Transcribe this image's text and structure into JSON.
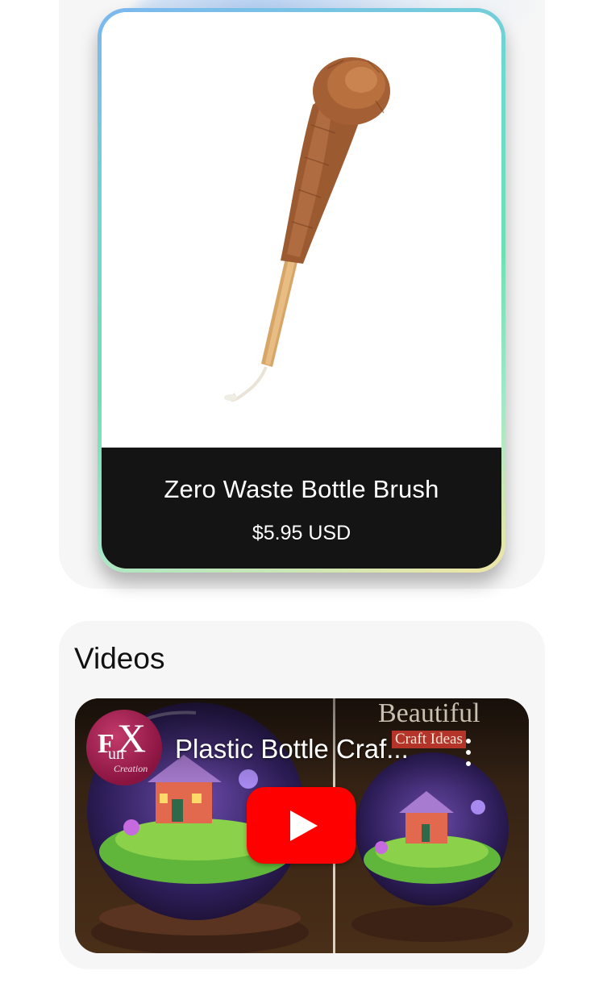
{
  "product": {
    "title": "Zero Waste Bottle Brush",
    "price": "$5.95 USD",
    "image": "bottle-brush-photo"
  },
  "videos": {
    "heading": "Videos",
    "items": [
      {
        "title": "Plastic Bottle Craf...",
        "channel_avatar": {
          "logo_text_f": "F",
          "logo_text_x": "X",
          "logo_text_un": "un",
          "logo_text_creation": "Creation"
        },
        "thumbnail_text": "Beautiful",
        "thumbnail_subtext": "Craft Ideas",
        "thumbnail": "terrarium-globe-house",
        "play_icon": "youtube-play-icon",
        "menu_icon": "more-vertical-icon"
      }
    ]
  },
  "colors": {
    "card_border_gradient": [
      "#7bb7f0",
      "#6fe0b4",
      "#f0e6a4"
    ],
    "info_band": "#141414",
    "section_bg": "#f6f6f6",
    "play_button": "#ff0000"
  }
}
